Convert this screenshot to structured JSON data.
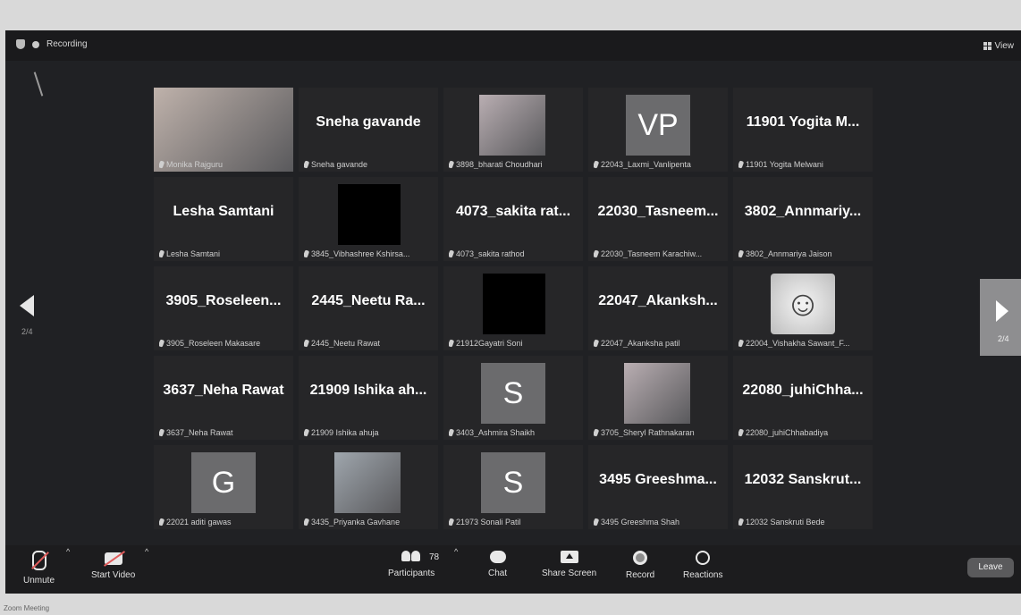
{
  "header": {
    "recording_label": "Recording",
    "view_label": "View"
  },
  "pagination": {
    "left": "2/4",
    "right": "2/4"
  },
  "tiles": [
    {
      "title": "",
      "label": "Monika Rajguru",
      "avatar": "",
      "photo": true
    },
    {
      "title": "Sneha gavande",
      "label": "Sneha gavande",
      "avatar": ""
    },
    {
      "title": "",
      "label": "3898_bharati Choudhari",
      "avatar": "",
      "photo": true
    },
    {
      "title": "",
      "label": "22043_Laxmi_Vanlipenta",
      "avatar": "VP"
    },
    {
      "title": "11901 Yogita M...",
      "label": "11901 Yogita Melwani",
      "avatar": ""
    },
    {
      "title": "Lesha Samtani",
      "label": "Lesha Samtani",
      "avatar": ""
    },
    {
      "title": "",
      "label": "3845_Vibhashree Kshirsa...",
      "avatar": "",
      "black": true
    },
    {
      "title": "4073_sakita rat...",
      "label": "4073_sakita rathod",
      "avatar": ""
    },
    {
      "title": "22030_Tasneem...",
      "label": "22030_Tasneem Karachiw...",
      "avatar": ""
    },
    {
      "title": "3802_Annmariy...",
      "label": "3802_Annmariya Jaison",
      "avatar": ""
    },
    {
      "title": "3905_Roseleen...",
      "label": "3905_Roseleen Makasare",
      "avatar": ""
    },
    {
      "title": "2445_Neetu Ra...",
      "label": "2445_Neetu Rawat",
      "avatar": ""
    },
    {
      "title": "",
      "label": "21912Gayatri Soni",
      "avatar": "",
      "black": true
    },
    {
      "title": "22047_Akanksh...",
      "label": "22047_Akanksha patil",
      "avatar": ""
    },
    {
      "title": "",
      "label": "22004_Vishakha Sawant_F...",
      "avatar": "",
      "smiley": true
    },
    {
      "title": "3637_Neha Rawat",
      "label": "3637_Neha Rawat",
      "avatar": ""
    },
    {
      "title": "21909 Ishika ah...",
      "label": "21909 Ishika ahuja",
      "avatar": ""
    },
    {
      "title": "",
      "label": "3403_Ashmira Shaikh",
      "avatar": "S"
    },
    {
      "title": "",
      "label": "3705_Sheryl Rathnakaran",
      "avatar": "",
      "photo": true
    },
    {
      "title": "22080_juhiChha...",
      "label": "22080_juhiChhabadiya",
      "avatar": ""
    },
    {
      "title": "",
      "label": "22021 aditi gawas",
      "avatar": "G"
    },
    {
      "title": "",
      "label": "3435_Priyanka Gavhane",
      "avatar": "",
      "photo": true
    },
    {
      "title": "",
      "label": "21973 Sonali Patil",
      "avatar": "S"
    },
    {
      "title": "3495 Greeshma...",
      "label": "3495 Greeshma Shah",
      "avatar": ""
    },
    {
      "title": "12032 Sanskrut...",
      "label": "12032 Sanskruti Bede",
      "avatar": ""
    }
  ],
  "toolbar": {
    "unmute": "Unmute",
    "start_video": "Start Video",
    "participants": "Participants",
    "participant_count": "78",
    "chat": "Chat",
    "share_screen": "Share Screen",
    "record": "Record",
    "reactions": "Reactions",
    "leave": "Leave"
  },
  "footer_text": "Zoom Meeting"
}
